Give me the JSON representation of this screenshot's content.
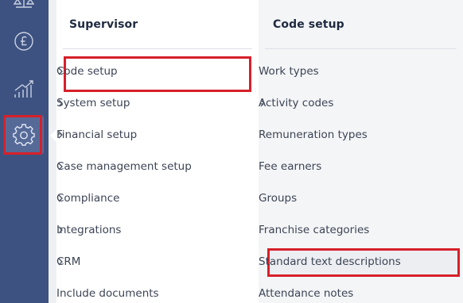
{
  "sidebar": {
    "items": [
      {
        "icon": "scale-icon"
      },
      {
        "icon": "pound-icon"
      },
      {
        "icon": "bar-chart-icon"
      },
      {
        "icon": "gear-icon",
        "active": true
      }
    ]
  },
  "supervisor_menu": {
    "title": "Supervisor",
    "items": [
      {
        "label": "Code setup",
        "has_submenu": true,
        "highlighted": true
      },
      {
        "label": "System setup",
        "has_submenu": true
      },
      {
        "label": "Financial setup",
        "has_submenu": true
      },
      {
        "label": "Case management setup",
        "has_submenu": true
      },
      {
        "label": "Compliance",
        "has_submenu": true
      },
      {
        "label": "Integrations",
        "has_submenu": true
      },
      {
        "label": "CRM",
        "has_submenu": true
      },
      {
        "label": "Include documents",
        "has_submenu": false
      }
    ]
  },
  "code_setup_menu": {
    "title": "Code setup",
    "items": [
      {
        "label": "Work types",
        "has_submenu": false
      },
      {
        "label": "Activity codes",
        "has_submenu": true
      },
      {
        "label": "Remuneration types",
        "has_submenu": false
      },
      {
        "label": "Fee earners",
        "has_submenu": false
      },
      {
        "label": "Groups",
        "has_submenu": false
      },
      {
        "label": "Franchise categories",
        "has_submenu": false
      },
      {
        "label": "Standard text descriptions",
        "has_submenu": false,
        "highlighted": true
      },
      {
        "label": "Attendance notes",
        "has_submenu": false
      }
    ]
  },
  "colors": {
    "sidebar_bg": "#3d5280",
    "highlight_border": "#d7202a",
    "title_text": "#1f2a40",
    "item_text": "#3c4454",
    "right_panel_bg": "#f4f5f7"
  }
}
